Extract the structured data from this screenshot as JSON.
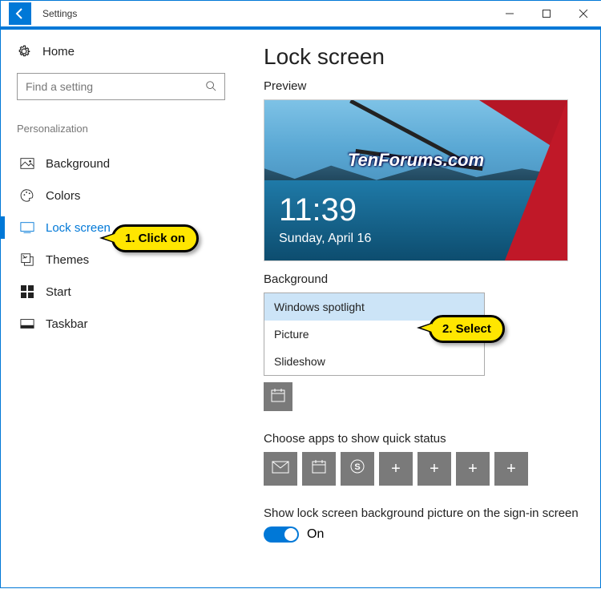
{
  "window": {
    "title": "Settings"
  },
  "sidebar": {
    "home_label": "Home",
    "search_placeholder": "Find a setting",
    "section_label": "Personalization",
    "items": [
      {
        "label": "Background"
      },
      {
        "label": "Colors"
      },
      {
        "label": "Lock screen"
      },
      {
        "label": "Themes"
      },
      {
        "label": "Start"
      },
      {
        "label": "Taskbar"
      }
    ]
  },
  "main": {
    "title": "Lock screen",
    "preview_label": "Preview",
    "preview_watermark": "TenForums.com",
    "preview_time": "11:39",
    "preview_date": "Sunday, April 16",
    "background_label": "Background",
    "dropdown": {
      "options": [
        {
          "label": "Windows spotlight"
        },
        {
          "label": "Picture"
        },
        {
          "label": "Slideshow"
        }
      ]
    },
    "quick_status_label": "Choose apps to show quick status",
    "signin_toggle_label": "Show lock screen background picture on the sign-in screen",
    "signin_toggle_state": "On"
  },
  "annotations": {
    "callout1": "1. Click on",
    "callout2": "2. Select"
  }
}
